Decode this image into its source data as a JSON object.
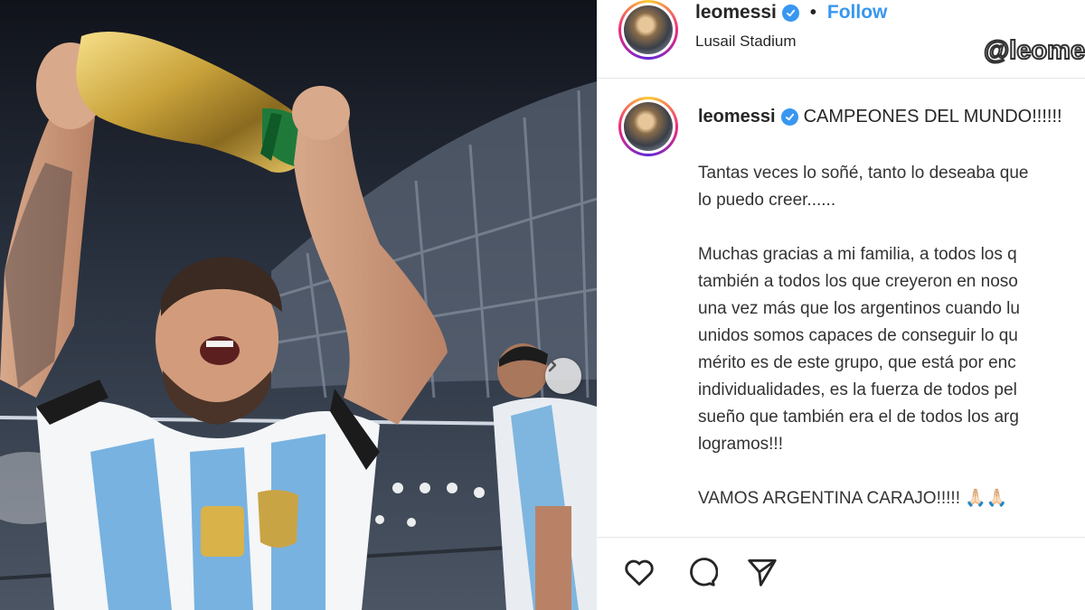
{
  "post": {
    "username": "leomessi",
    "separator": "•",
    "follow_label": "Follow",
    "location": "Lusail Stadium",
    "watermark": "@leomessi",
    "caption_headline": "CAMPEONES DEL MUNDO!!!!!!",
    "caption_body": "Tantas veces lo soñé, tanto lo deseaba que\nlo puedo creer......\n\nMuchas gracias a mi familia, a todos los q\ntambién a todos los que creyeron en noso\nuna vez más que los argentinos cuando lu\nunidos somos capaces de conseguir lo qu\nmérito es de este grupo, que está por enc\nindividualidades, es la fuerza de todos pel\nsueño que también era el de todos los arg\nlogramos!!!\n\nVAMOS ARGENTINA CARAJO!!!!! 🙏🏻🙏🏻"
  },
  "icons": {
    "verified": "verified-badge-icon",
    "carousel": "chevron-right-icon",
    "like": "heart-icon",
    "comment": "comment-icon",
    "share": "paper-plane-icon"
  },
  "colors": {
    "accent_blue": "#3897f0",
    "text": "#262626",
    "divider": "#e6e6e6"
  }
}
